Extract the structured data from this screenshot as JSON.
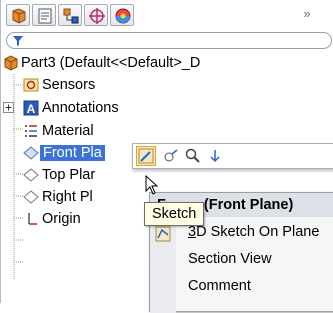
{
  "toolbar": {
    "buttons": [
      {
        "name": "feature-manager-tab",
        "icon": "feature-tree-icon"
      },
      {
        "name": "property-manager-tab",
        "icon": "property-manager-icon"
      },
      {
        "name": "configuration-manager-tab",
        "icon": "configuration-manager-icon"
      },
      {
        "name": "dimxpert-manager-tab",
        "icon": "dimxpert-icon"
      },
      {
        "name": "display-manager-tab",
        "icon": "display-manager-icon"
      }
    ],
    "overflow_label": "»"
  },
  "filter": {
    "icon": "filter-icon"
  },
  "tree": {
    "root_label": "Part3  (Default<<Default>_D",
    "items": [
      {
        "label": "Sensors",
        "icon": "sensors-icon"
      },
      {
        "label": "Annotations",
        "icon": "annotations-icon",
        "expander": "⊞"
      },
      {
        "label": "Material",
        "icon": "material-icon"
      },
      {
        "label": "Front Pla",
        "icon": "plane-icon"
      },
      {
        "label": "Top Plar",
        "icon": "plane-icon"
      },
      {
        "label": "Right Pl",
        "icon": "plane-icon"
      },
      {
        "label": "Origin",
        "icon": "origin-icon"
      }
    ]
  },
  "context_toolbar": {
    "icons": [
      "sketch-icon",
      "normal-to-icon",
      "zoom-to-selection-icon",
      "hide-show-icon"
    ]
  },
  "context_menu": {
    "title_visible": "(Front Plane)",
    "title_prefix": "F",
    "items": [
      {
        "label": "3D Sketch On Plane",
        "mnemonic": "3"
      },
      {
        "label": "Section View",
        "mnemonic": "e"
      },
      {
        "label": "Comment",
        "mnemonic": "C"
      }
    ]
  },
  "tooltip": {
    "text": "Sketch"
  },
  "colors": {
    "selection": "#3d73d6",
    "menu_header": "#dde1e7",
    "tooltip_bg": "#ffffe6"
  }
}
